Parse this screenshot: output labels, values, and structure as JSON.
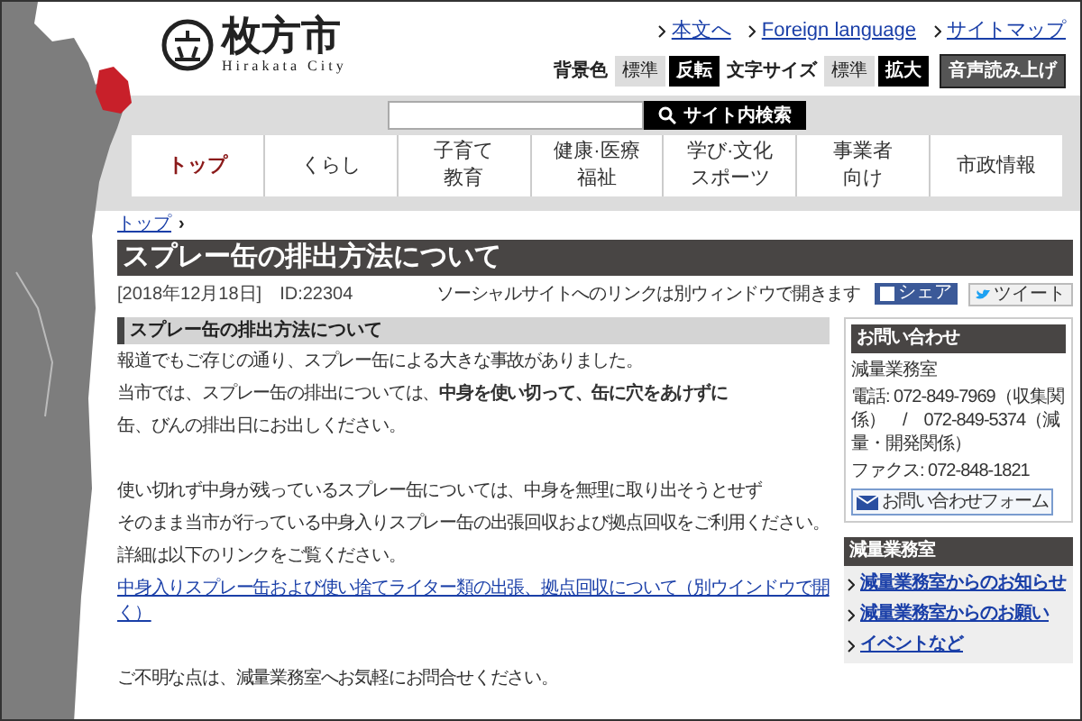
{
  "header": {
    "logo_title": "枚方市",
    "logo_subtitle": "Hirakata City",
    "links": [
      {
        "label": "本文へ"
      },
      {
        "label": "Foreign language"
      },
      {
        "label": "サイトマップ"
      }
    ],
    "settings": [
      {
        "label": "背景色",
        "options": [
          {
            "label": "標準",
            "kind": "light"
          },
          {
            "label": "反転",
            "kind": "dark"
          }
        ]
      },
      {
        "label": "文字サイズ",
        "options": [
          {
            "label": "標準",
            "kind": "light"
          },
          {
            "label": "拡大",
            "kind": "dark"
          }
        ]
      }
    ],
    "voice_button": "音声読み上げ"
  },
  "search": {
    "button": "サイト内検索"
  },
  "nav": [
    {
      "lines": [
        "トップ"
      ],
      "selected": true
    },
    {
      "lines": [
        "くらし"
      ],
      "selected": false
    },
    {
      "lines": [
        "子育て",
        "教育"
      ],
      "selected": false
    },
    {
      "lines": [
        "健康·医療",
        "福祉"
      ],
      "selected": false
    },
    {
      "lines": [
        "学び·文化",
        "スポーツ"
      ],
      "selected": false
    },
    {
      "lines": [
        "事業者",
        "向け"
      ],
      "selected": false
    },
    {
      "lines": [
        "市政情報"
      ],
      "selected": false
    }
  ],
  "breadcrumb": [
    {
      "label": "トップ"
    }
  ],
  "breadcrumb_separator": "›",
  "page_title": "スプレー缶の排出方法について",
  "meta": {
    "date": "[2018年12月18日]",
    "id": "ID:22304",
    "social_note": "ソーシャルサイトへのリンクは別ウィンドウで開きます",
    "share": "シェア",
    "tweet": "ツイート"
  },
  "article": {
    "heading": "スプレー缶の排出方法について",
    "paragraphs": [
      {
        "kind": "text",
        "text": "報道でもご存じの通り、スプレー缶による大きな事故がありました。"
      },
      {
        "kind": "text",
        "text": "当市では、スプレー缶の排出については、**中身を使い切って、缶に穴をあけずに**"
      },
      {
        "kind": "text",
        "text": "缶、びんの排出日にお出しください。"
      },
      {
        "kind": "blank"
      },
      {
        "kind": "text",
        "text": "使い切れず中身が残っているスプレー缶については、中身を無理に取り出そうとせず"
      },
      {
        "kind": "text",
        "text": "そのまま当市が行っている中身入りスプレー缶の出張回収および拠点回収をご利用ください。"
      },
      {
        "kind": "text",
        "text": "詳細は以下のリンクをご覧ください。"
      },
      {
        "kind": "link",
        "text": "中身入りスプレー缶および使い捨てライター類の出張、拠点回収について（別ウインドウで開く）"
      },
      {
        "kind": "blank"
      },
      {
        "kind": "text",
        "text": "ご不明な点は、減量業務室へお気軽にお問合せください。"
      }
    ]
  },
  "sidebar": {
    "contact": {
      "title": "お問い合わせ",
      "department": "減量業務室",
      "phone": "電話: 072-849-7969（収集関係）　/　072-849-5374（減量・開発関係）",
      "fax": "ファクス: 072-848-1821",
      "form_button": "お問い合わせフォーム"
    },
    "department_box": {
      "title": "減量業務室",
      "links": [
        {
          "label": "減量業務室からのお知らせ"
        },
        {
          "label": "減量業務室からのお願い"
        },
        {
          "label": "イベントなど"
        }
      ]
    }
  }
}
